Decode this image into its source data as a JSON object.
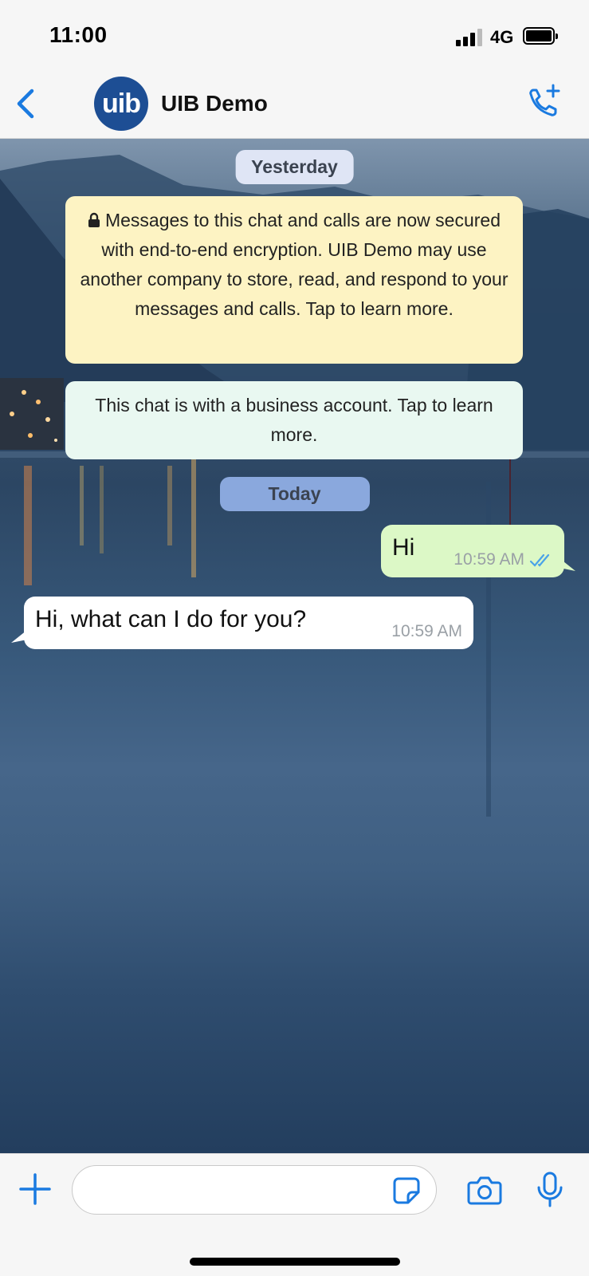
{
  "status_bar": {
    "time": "11:00",
    "network": "4G",
    "signal_icon": "cellular-signal-icon",
    "battery_icon": "battery-icon"
  },
  "header": {
    "back_icon": "chevron-left-icon",
    "avatar_text": "uib",
    "contact_name": "UIB Demo",
    "call_icon": "phone-add-icon",
    "accent_color": "#1a7ae0"
  },
  "chat": {
    "date_yesterday": "Yesterday",
    "encryption_notice": "Messages to this chat and calls are now secured with end-to-end encryption. UIB Demo may use another company to store, read, and respond to your messages and calls. Tap to learn more.",
    "business_notice": "This chat is with a business account. Tap to learn more.",
    "date_today": "Today",
    "messages": [
      {
        "direction": "outgoing",
        "text": "Hi",
        "time": "10:59 AM",
        "status": "read"
      },
      {
        "direction": "incoming",
        "text": "Hi, what can I do for you?",
        "time": "10:59 AM"
      }
    ]
  },
  "composer": {
    "input_value": "",
    "plus_icon": "plus-icon",
    "sticker_icon": "sticker-icon",
    "camera_icon": "camera-icon",
    "mic_icon": "microphone-icon"
  }
}
